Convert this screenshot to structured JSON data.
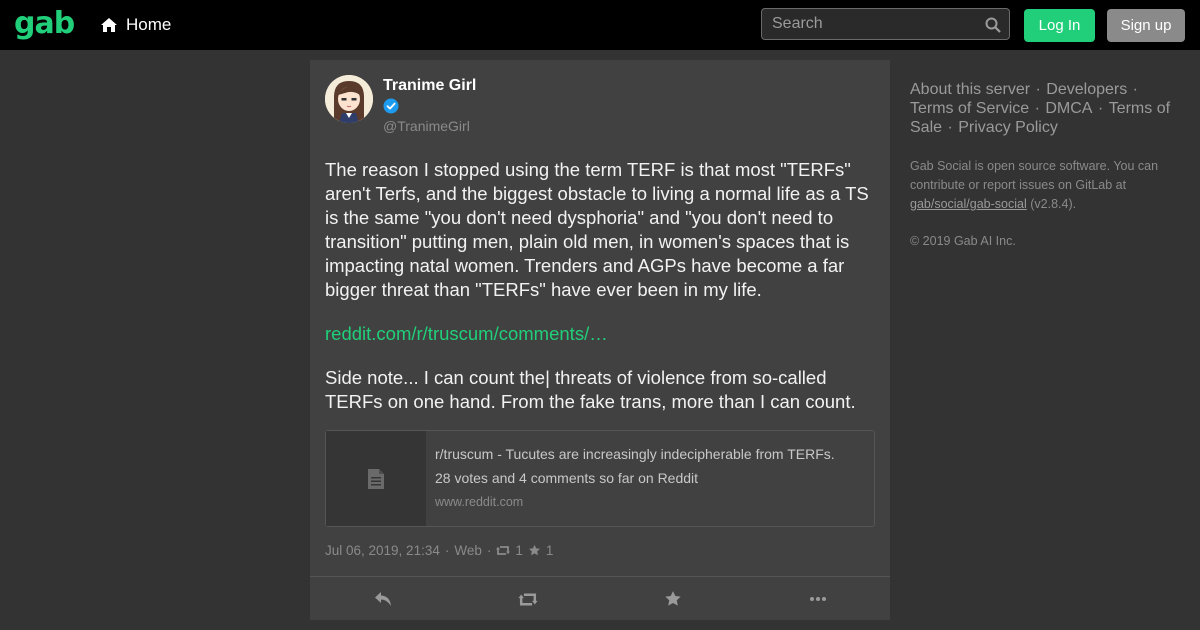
{
  "header": {
    "logo": "gab",
    "home_label": "Home",
    "search_placeholder": "Search",
    "login_label": "Log In",
    "signup_label": "Sign up"
  },
  "post": {
    "author_name": "Tranime Girl",
    "author_handle": "@TranimeGirl",
    "paragraph_1": "The reason I stopped using the term TERF is that most \"TERFs\" aren't Terfs, and the biggest obstacle to living a normal life as a TS is the same \"you don't need dysphoria\" and \"you don't need to transition\" putting men, plain old men, in women's spaces that is impacting natal women. Trenders and AGPs have become a far bigger threat than \"TERFs\" have ever been in my life.",
    "link_text": "reddit.com/r/truscum/comments/…",
    "paragraph_2": "Side note... I can count the| threats of violence from so-called TERFs on one hand. From the fake trans, more than I can count.",
    "preview": {
      "title": "r/truscum - Tucutes are increasingly indecipherable from TERFs.",
      "description": "28 votes and 4 comments so far on Reddit",
      "domain": "www.reddit.com"
    },
    "meta": {
      "timestamp": "Jul 06, 2019, 21:34",
      "separator": "·",
      "client": "Web",
      "reposts": "1",
      "favorites": "1"
    }
  },
  "sidebar": {
    "links": [
      "About this server",
      "Developers",
      "Terms of Service",
      "DMCA",
      "Terms of Sale",
      "Privacy Policy"
    ],
    "info_prefix": "Gab Social is open source software. You can contribute or report issues on GitLab at ",
    "repo_link": "gab/social/gab-social",
    "version": "(v2.8.4).",
    "copyright": "© 2019 Gab AI Inc."
  },
  "colors": {
    "accent": "#21cf7a",
    "background": "#333333",
    "card": "#414141",
    "verified": "#1d9bf0"
  }
}
